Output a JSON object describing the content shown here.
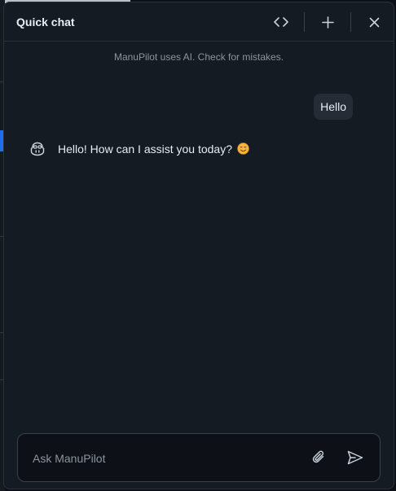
{
  "header": {
    "title": "Quick chat"
  },
  "disclaimer": "ManuPilot uses AI. Check for mistakes.",
  "messages": {
    "user": "Hello",
    "assistant": "Hello! How can I assist you today?"
  },
  "composer": {
    "placeholder": "Ask ManuPilot"
  },
  "colors": {
    "panel_bg": "#151b23",
    "page_bg": "#0d1117",
    "text": "#e6edf3",
    "muted": "#8b949e",
    "bubble_bg": "#262c36",
    "border": "#2a313c"
  },
  "icons": {
    "header": [
      "code-icon",
      "plus-icon",
      "close-icon"
    ],
    "assistant_avatar": "copilot-icon",
    "emoji": "smiling-face-icon",
    "composer": [
      "paperclip-icon",
      "send-icon"
    ]
  }
}
